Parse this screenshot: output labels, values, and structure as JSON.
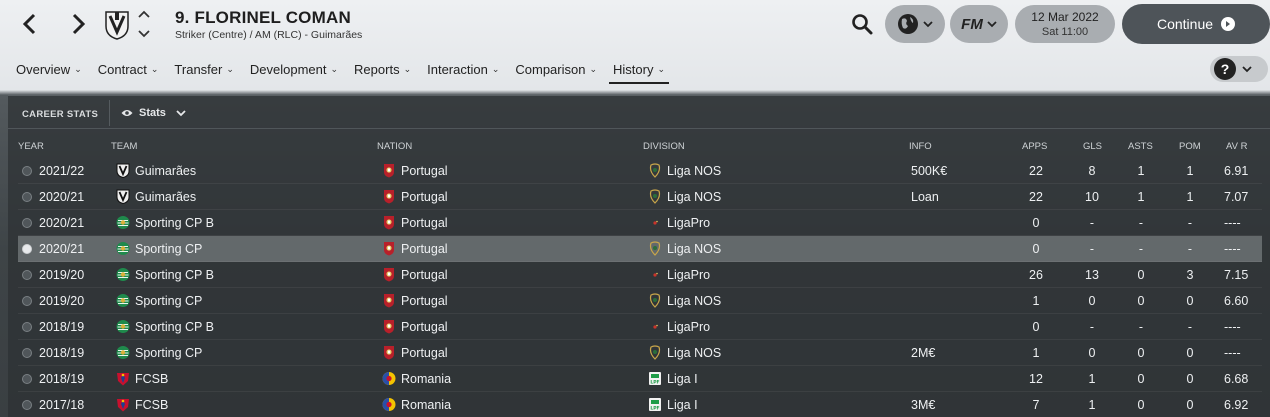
{
  "header": {
    "player_name": "9. FLORINEL COMAN",
    "player_sub": "Striker (Centre) / AM (RLC) - Guimarães",
    "date": "12 Mar 2022",
    "time": "Sat 11:00",
    "continue_label": "Continue",
    "fm_label": "FM"
  },
  "tabs": [
    {
      "label": "Overview"
    },
    {
      "label": "Contract"
    },
    {
      "label": "Transfer"
    },
    {
      "label": "Development"
    },
    {
      "label": "Reports"
    },
    {
      "label": "Interaction"
    },
    {
      "label": "Comparison"
    },
    {
      "label": "History"
    }
  ],
  "active_tab": "History",
  "help_label": "?",
  "panel": {
    "title": "CAREER STATS",
    "view_label": "Stats"
  },
  "columns": {
    "year": "YEAR",
    "team": "TEAM",
    "nation": "NATION",
    "division": "DIVISION",
    "info": "INFO",
    "apps": "APPS",
    "gls": "GLS",
    "asts": "ASTS",
    "pom": "POM",
    "avr": "AV R"
  },
  "rows": [
    {
      "year": "2021/22",
      "team": "Guimarães",
      "team_icon": "guimaraes-crest",
      "nation": "Portugal",
      "division": "Liga NOS",
      "div_icon": "liga-nos-logo",
      "info": "500K€",
      "apps": "22",
      "gls": "8",
      "asts": "1",
      "pom": "1",
      "avr": "6.91"
    },
    {
      "year": "2020/21",
      "team": "Guimarães",
      "team_icon": "guimaraes-crest",
      "nation": "Portugal",
      "division": "Liga NOS",
      "div_icon": "liga-nos-logo",
      "info": "Loan",
      "apps": "22",
      "gls": "10",
      "asts": "1",
      "pom": "1",
      "avr": "7.07"
    },
    {
      "year": "2020/21",
      "team": "Sporting CP B",
      "team_icon": "sporting-crest",
      "nation": "Portugal",
      "division": "LigaPro",
      "div_icon": "ligapro-logo",
      "info": "",
      "apps": "0",
      "gls": "-",
      "asts": "-",
      "pom": "-",
      "avr": "----"
    },
    {
      "year": "2020/21",
      "team": "Sporting CP",
      "team_icon": "sporting-crest",
      "nation": "Portugal",
      "division": "Liga NOS",
      "div_icon": "liga-nos-logo",
      "info": "",
      "apps": "0",
      "gls": "-",
      "asts": "-",
      "pom": "-",
      "avr": "----"
    },
    {
      "year": "2019/20",
      "team": "Sporting CP B",
      "team_icon": "sporting-crest",
      "nation": "Portugal",
      "division": "LigaPro",
      "div_icon": "ligapro-logo",
      "info": "",
      "apps": "26",
      "gls": "13",
      "asts": "0",
      "pom": "3",
      "avr": "7.15"
    },
    {
      "year": "2019/20",
      "team": "Sporting CP",
      "team_icon": "sporting-crest",
      "nation": "Portugal",
      "division": "Liga NOS",
      "div_icon": "liga-nos-logo",
      "info": "",
      "apps": "1",
      "gls": "0",
      "asts": "0",
      "pom": "0",
      "avr": "6.60"
    },
    {
      "year": "2018/19",
      "team": "Sporting CP B",
      "team_icon": "sporting-crest",
      "nation": "Portugal",
      "division": "LigaPro",
      "div_icon": "ligapro-logo",
      "info": "",
      "apps": "0",
      "gls": "-",
      "asts": "-",
      "pom": "-",
      "avr": "----"
    },
    {
      "year": "2018/19",
      "team": "Sporting CP",
      "team_icon": "sporting-crest",
      "nation": "Portugal",
      "division": "Liga NOS",
      "div_icon": "liga-nos-logo",
      "info": "2M€",
      "apps": "1",
      "gls": "0",
      "asts": "0",
      "pom": "0",
      "avr": "----"
    },
    {
      "year": "2018/19",
      "team": "FCSB",
      "team_icon": "fcsb-crest",
      "nation": "Romania",
      "division": "Liga I",
      "div_icon": "liga-i-logo",
      "info": "",
      "apps": "12",
      "gls": "1",
      "asts": "0",
      "pom": "0",
      "avr": "6.68"
    },
    {
      "year": "2017/18",
      "team": "FCSB",
      "team_icon": "fcsb-crest",
      "nation": "Romania",
      "division": "Liga I",
      "div_icon": "liga-i-logo",
      "info": "3M€",
      "apps": "7",
      "gls": "1",
      "asts": "0",
      "pom": "0",
      "avr": "6.92"
    }
  ],
  "selected_row": 3,
  "colors": {
    "panel_bg": "#2c3033",
    "selected_row": "#7f8487",
    "sporting_green": "#1f8a4c",
    "portugal_red": "#b8202a",
    "fcsb_red": "#c8102e"
  }
}
